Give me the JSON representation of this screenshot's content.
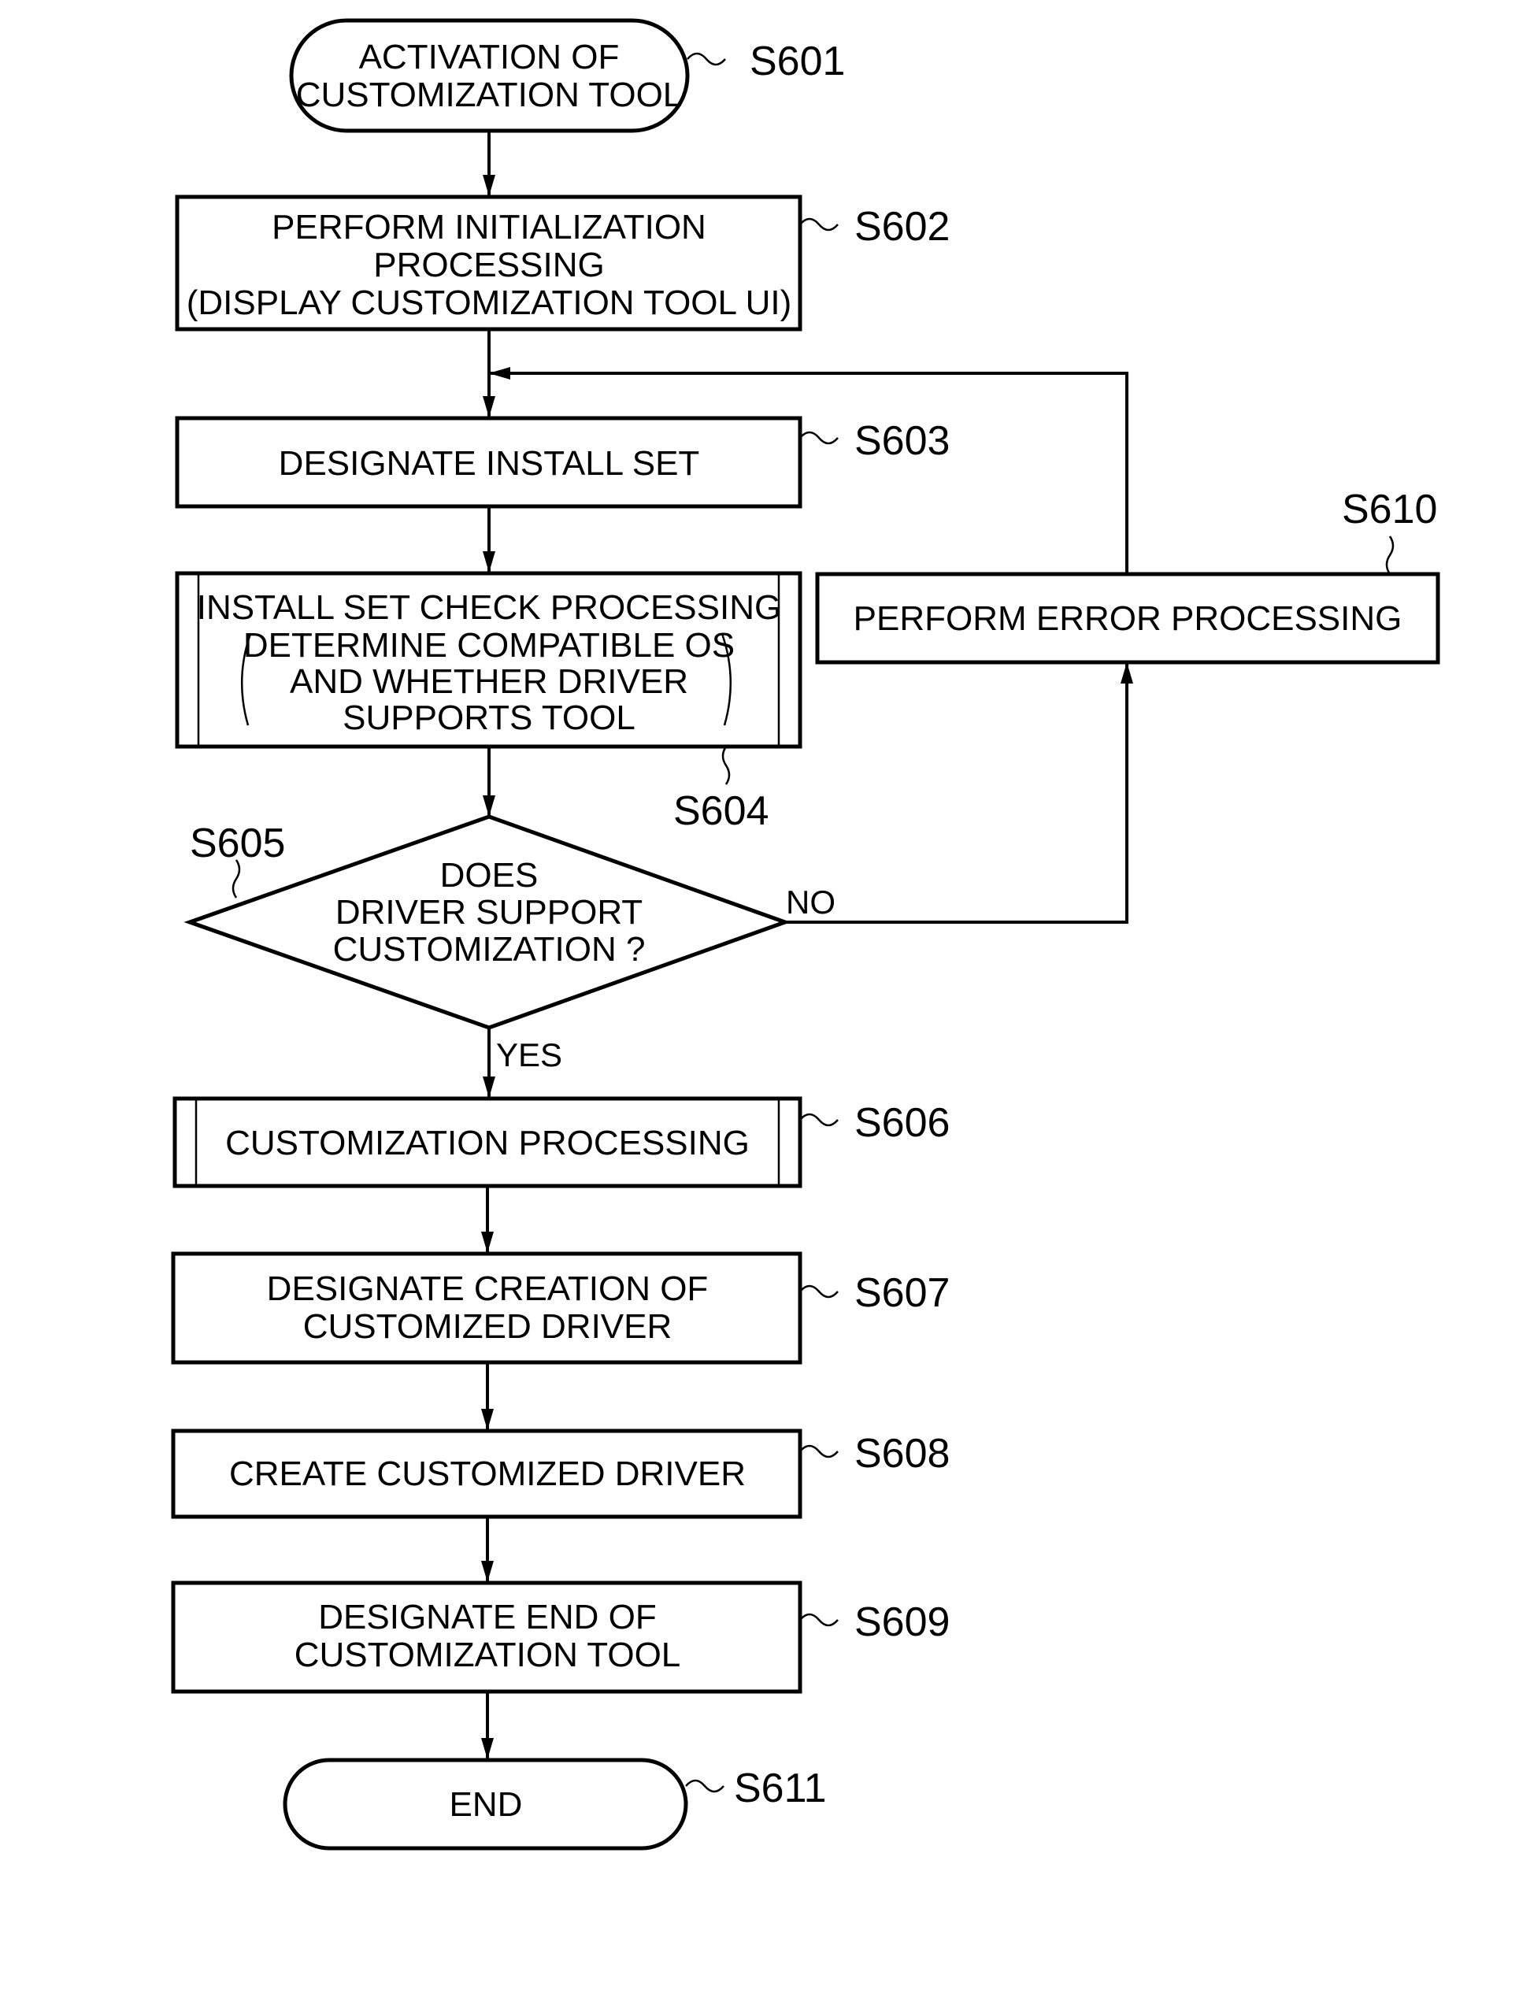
{
  "diagram": {
    "type": "flowchart",
    "steps": {
      "s601": {
        "id": "S601",
        "shape": "terminal",
        "lines": [
          "ACTIVATION OF",
          "CUSTOMIZATION TOOL"
        ]
      },
      "s602": {
        "id": "S602",
        "shape": "process",
        "lines": [
          "PERFORM INITIALIZATION",
          "PROCESSING",
          "(DISPLAY CUSTOMIZATION TOOL UI)"
        ]
      },
      "s603": {
        "id": "S603",
        "shape": "process",
        "lines": [
          "DESIGNATE INSTALL SET"
        ]
      },
      "s604": {
        "id": "S604",
        "shape": "subroutine",
        "lines": [
          "INSTALL SET CHECK PROCESSING",
          "DETERMINE COMPATIBLE OS",
          "AND WHETHER DRIVER",
          "SUPPORTS TOOL"
        ]
      },
      "s605": {
        "id": "S605",
        "shape": "decision",
        "lines": [
          "DOES",
          "DRIVER SUPPORT",
          "CUSTOMIZATION ?"
        ],
        "yes_label": "YES",
        "no_label": "NO"
      },
      "s606": {
        "id": "S606",
        "shape": "subroutine",
        "lines": [
          "CUSTOMIZATION PROCESSING"
        ]
      },
      "s607": {
        "id": "S607",
        "shape": "process",
        "lines": [
          "DESIGNATE CREATION OF",
          "CUSTOMIZED DRIVER"
        ]
      },
      "s608": {
        "id": "S608",
        "shape": "process",
        "lines": [
          "CREATE CUSTOMIZED DRIVER"
        ]
      },
      "s609": {
        "id": "S609",
        "shape": "process",
        "lines": [
          "DESIGNATE END OF",
          "CUSTOMIZATION TOOL"
        ]
      },
      "s610": {
        "id": "S610",
        "shape": "process",
        "lines": [
          "PERFORM ERROR PROCESSING"
        ]
      },
      "s611": {
        "id": "S611",
        "shape": "terminal",
        "lines": [
          "END"
        ]
      }
    },
    "edges": [
      {
        "from": "S601",
        "to": "S602"
      },
      {
        "from": "S602",
        "to": "S603"
      },
      {
        "from": "S603",
        "to": "S604"
      },
      {
        "from": "S604",
        "to": "S605"
      },
      {
        "from": "S605",
        "to": "S606",
        "label": "YES"
      },
      {
        "from": "S605",
        "to": "S610",
        "label": "NO"
      },
      {
        "from": "S610",
        "to": "S603"
      },
      {
        "from": "S606",
        "to": "S607"
      },
      {
        "from": "S607",
        "to": "S608"
      },
      {
        "from": "S608",
        "to": "S609"
      },
      {
        "from": "S609",
        "to": "S611"
      }
    ]
  }
}
